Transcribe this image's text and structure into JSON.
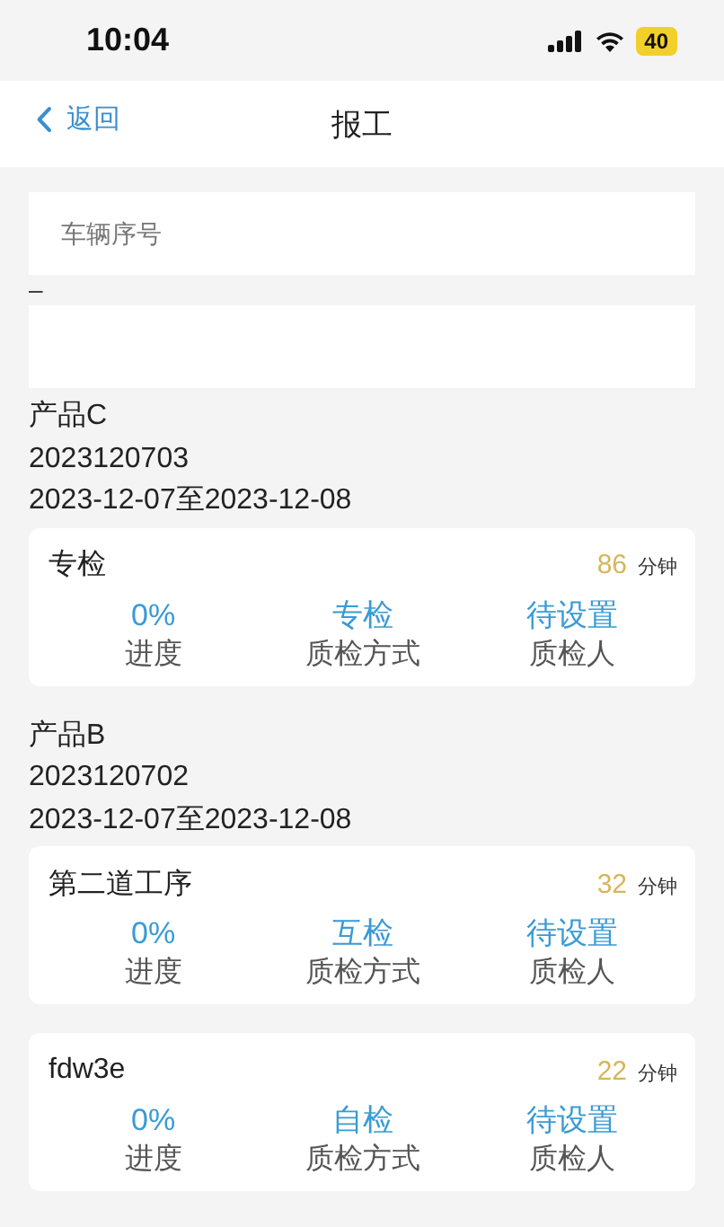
{
  "status_bar": {
    "time": "10:04",
    "battery": "40"
  },
  "nav": {
    "back": "返回",
    "title": "报工"
  },
  "vehicle_field": {
    "placeholder": "车辆序号"
  },
  "separator_text": "–",
  "products": [
    {
      "name": "产品C",
      "code": "2023120703",
      "dates": "2023-12-07至2023-12-08",
      "tasks": [
        {
          "title": "专检",
          "minutes": "86",
          "unit": "分钟",
          "stats": [
            {
              "value": "0%",
              "label": "进度"
            },
            {
              "value": "专检",
              "label": "质检方式"
            },
            {
              "value": "待设置",
              "label": "质检人"
            }
          ]
        }
      ]
    },
    {
      "name": "产品B",
      "code": "2023120702",
      "dates": "2023-12-07至2023-12-08",
      "tasks": [
        {
          "title": "第二道工序",
          "minutes": "32",
          "unit": "分钟",
          "stats": [
            {
              "value": "0%",
              "label": "进度"
            },
            {
              "value": "互检",
              "label": "质检方式"
            },
            {
              "value": "待设置",
              "label": "质检人"
            }
          ]
        },
        {
          "title": "fdw3e",
          "minutes": "22",
          "unit": "分钟",
          "stats": [
            {
              "value": "0%",
              "label": "进度"
            },
            {
              "value": "自检",
              "label": "质检方式"
            },
            {
              "value": "待设置",
              "label": "质检人"
            }
          ]
        }
      ]
    }
  ]
}
